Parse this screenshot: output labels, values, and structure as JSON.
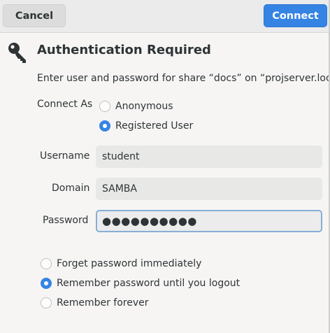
{
  "header": {
    "cancel_label": "Cancel",
    "connect_label": "Connect"
  },
  "dialog": {
    "title": "Authentication Required",
    "message": "Enter user and password for share “docs” on “projserver.local”:"
  },
  "connect_as": {
    "label": "Connect As",
    "options": [
      {
        "label": "Anonymous",
        "selected": false
      },
      {
        "label": "Registered User",
        "selected": true
      }
    ]
  },
  "form": {
    "username_label": "Username",
    "username_value": "student",
    "domain_label": "Domain",
    "domain_value": "SAMBA",
    "password_label": "Password",
    "password_value": "●●●●●●●●●●"
  },
  "remember": {
    "options": [
      {
        "label": "Forget password immediately",
        "selected": false
      },
      {
        "label": "Remember password until you logout",
        "selected": true
      },
      {
        "label": "Remember forever",
        "selected": false
      }
    ]
  },
  "colors": {
    "accent": "#3584e4",
    "background": "#f6f5f4"
  }
}
